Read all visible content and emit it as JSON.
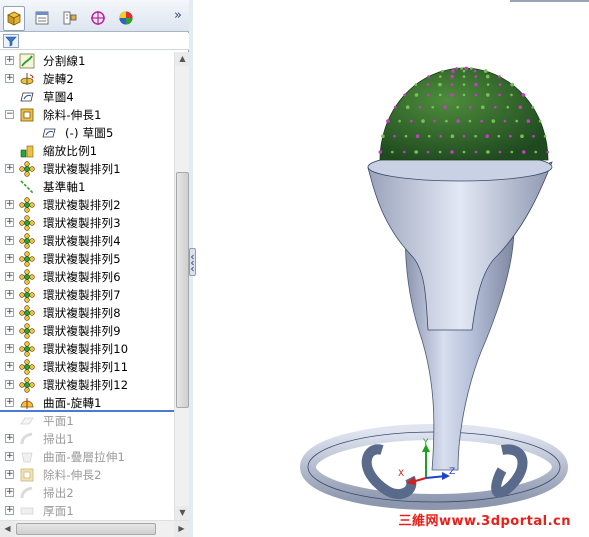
{
  "panel_tabs": [
    {
      "name": "feature-manager-tab",
      "active": true
    },
    {
      "name": "property-manager-tab",
      "active": false
    },
    {
      "name": "configuration-manager-tab",
      "active": false
    },
    {
      "name": "dimxpert-manager-tab",
      "active": false
    },
    {
      "name": "display-manager-tab",
      "active": false
    }
  ],
  "tree": [
    {
      "label": "分割線1",
      "icon": "split-line-icon",
      "expander": "+",
      "indent": 0,
      "dimmed": false
    },
    {
      "label": "旋轉2",
      "icon": "revolve-icon",
      "expander": "+",
      "indent": 0,
      "dimmed": false
    },
    {
      "label": "草圖4",
      "icon": "sketch-icon",
      "expander": "",
      "indent": 0,
      "dimmed": false
    },
    {
      "label": "除料-伸長1",
      "icon": "extruded-cut-icon",
      "expander": "-",
      "indent": 0,
      "dimmed": false
    },
    {
      "label": "(-) 草圖5",
      "icon": "sketch-icon",
      "expander": "",
      "indent": 1,
      "dimmed": false
    },
    {
      "label": "縮放比例1",
      "icon": "scale-icon",
      "expander": "",
      "indent": 0,
      "dimmed": false
    },
    {
      "label": "環狀複製排列1",
      "icon": "circular-pattern-icon",
      "expander": "+",
      "indent": 0,
      "dimmed": false
    },
    {
      "label": "基準軸1",
      "icon": "axis-icon",
      "expander": "",
      "indent": 0,
      "dimmed": false
    },
    {
      "label": "環狀複製排列2",
      "icon": "circular-pattern-icon",
      "expander": "+",
      "indent": 0,
      "dimmed": false
    },
    {
      "label": "環狀複製排列3",
      "icon": "circular-pattern-icon",
      "expander": "+",
      "indent": 0,
      "dimmed": false
    },
    {
      "label": "環狀複製排列4",
      "icon": "circular-pattern-icon",
      "expander": "+",
      "indent": 0,
      "dimmed": false
    },
    {
      "label": "環狀複製排列5",
      "icon": "circular-pattern-icon",
      "expander": "+",
      "indent": 0,
      "dimmed": false
    },
    {
      "label": "環狀複製排列6",
      "icon": "circular-pattern-icon",
      "expander": "+",
      "indent": 0,
      "dimmed": false
    },
    {
      "label": "環狀複製排列7",
      "icon": "circular-pattern-icon",
      "expander": "+",
      "indent": 0,
      "dimmed": false
    },
    {
      "label": "環狀複製排列8",
      "icon": "circular-pattern-icon",
      "expander": "+",
      "indent": 0,
      "dimmed": false
    },
    {
      "label": "環狀複製排列9",
      "icon": "circular-pattern-icon",
      "expander": "+",
      "indent": 0,
      "dimmed": false
    },
    {
      "label": "環狀複製排列10",
      "icon": "circular-pattern-icon",
      "expander": "+",
      "indent": 0,
      "dimmed": false
    },
    {
      "label": "環狀複製排列11",
      "icon": "circular-pattern-icon",
      "expander": "+",
      "indent": 0,
      "dimmed": false
    },
    {
      "label": "環狀複製排列12",
      "icon": "circular-pattern-icon",
      "expander": "+",
      "indent": 0,
      "dimmed": false
    },
    {
      "label": "曲面-旋轉1",
      "icon": "surface-revolve-icon",
      "expander": "+",
      "indent": 0,
      "dimmed": false
    },
    {
      "label": "平面1",
      "icon": "plane-icon",
      "expander": "",
      "indent": 0,
      "dimmed": true
    },
    {
      "label": "掃出1",
      "icon": "sweep-icon",
      "expander": "+",
      "indent": 0,
      "dimmed": true
    },
    {
      "label": "曲面-疊層拉伸1",
      "icon": "surface-loft-icon",
      "expander": "+",
      "indent": 0,
      "dimmed": true
    },
    {
      "label": "除料-伸長2",
      "icon": "extruded-cut-icon",
      "expander": "+",
      "indent": 0,
      "dimmed": true
    },
    {
      "label": "掃出2",
      "icon": "sweep-icon",
      "expander": "+",
      "indent": 0,
      "dimmed": true
    },
    {
      "label": "厚面1",
      "icon": "thicken-icon",
      "expander": "+",
      "indent": 0,
      "dimmed": true
    }
  ],
  "triad": {
    "x": "X",
    "y": "Y",
    "z": "Z"
  },
  "watermark": "三維网www.3dportal.cn",
  "colors": {
    "accent": "#4a7bd4",
    "model": "#b9c3da",
    "watermark": "#e8201a",
    "spike_tip": "#c040c0",
    "spike_base": "#3c7a3c"
  }
}
